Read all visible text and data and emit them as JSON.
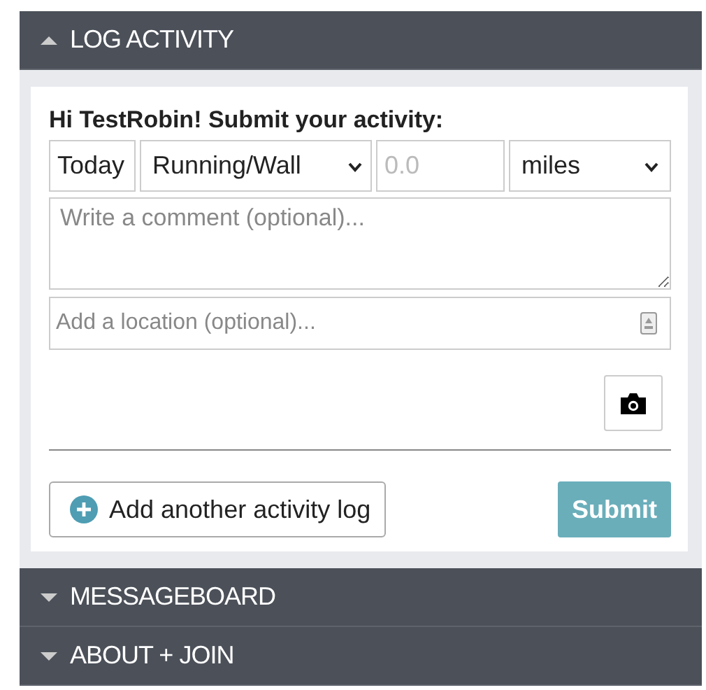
{
  "sections": [
    {
      "title": "LOG ACTIVITY",
      "expanded": true
    },
    {
      "title": "MESSAGEBOARD",
      "expanded": false
    },
    {
      "title": "ABOUT + JOIN",
      "expanded": false
    }
  ],
  "form": {
    "greeting": "Hi TestRobin! Submit your activity:",
    "date": "Today",
    "activity": "Running/Wall",
    "amount": {
      "placeholder": "0.0"
    },
    "unit": "miles",
    "comment": {
      "placeholder": "Write a comment (optional)..."
    },
    "location": {
      "placeholder": "Add a location (optional)..."
    },
    "add_button": "Add another activity log",
    "submit_button": "Submit"
  }
}
